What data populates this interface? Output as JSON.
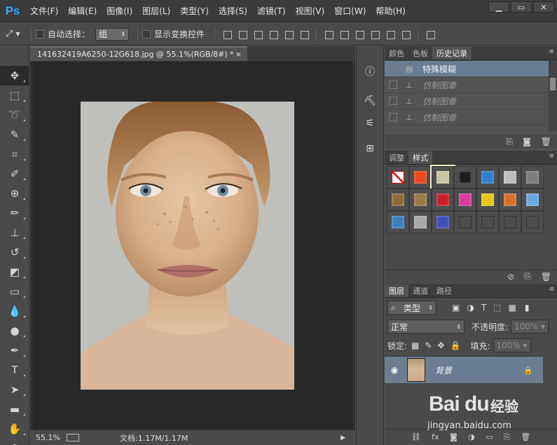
{
  "app": {
    "logo": "Ps"
  },
  "menu": [
    "文件(F)",
    "编辑(E)",
    "图像(I)",
    "图层(L)",
    "类型(Y)",
    "选择(S)",
    "滤镜(T)",
    "视图(V)",
    "窗口(W)",
    "帮助(H)"
  ],
  "window_controls": [
    "▁",
    "▭",
    "✕"
  ],
  "options": {
    "auto_select_label": "自动选择：",
    "auto_select_value": "组",
    "show_transform_label": "显示变换控件"
  },
  "document": {
    "tab_title": "141632419A6250-12G618.jpg @ 55.1%(RGB/8#) *",
    "tab_close": "×",
    "zoom": "55.1%",
    "doc_info": "文档:1.17M/1.17M",
    "status_arrow": "▶"
  },
  "history_panel": {
    "tabs": [
      "颜色",
      "色板",
      "历史记录"
    ],
    "active_tab": 2,
    "items": [
      {
        "label": "特殊模糊",
        "active": true
      },
      {
        "label": "仿制图章",
        "active": false
      },
      {
        "label": "仿制图章",
        "active": false
      },
      {
        "label": "仿制图章",
        "active": false
      }
    ]
  },
  "styles_panel": {
    "tabs": [
      "调整",
      "样式"
    ],
    "active_tab": 1,
    "swatches": [
      "none",
      "#e84a1c",
      "#c9c4a0",
      "#1c1c1c",
      "#2f7fd0",
      "#bdbdbd",
      "#7d7d7d",
      "#8d6a3a",
      "#9a7b46",
      "#c8202a",
      "#d63a9a",
      "#e8c51a",
      "#d4702a",
      "#6aa7e0",
      "#3e7fbe",
      "#a9a9a9",
      "#3f4fb8",
      "empty",
      "empty",
      "empty",
      "empty"
    ]
  },
  "layers_panel": {
    "tabs": [
      "图层",
      "通道",
      "路径"
    ],
    "active_tab": 0,
    "filter_kind": "类型",
    "blend_mode": "正常",
    "opacity_label": "不透明度:",
    "opacity_value": "100%",
    "lock_label": "锁定:",
    "fill_label": "填充:",
    "fill_value": "100%",
    "layers": [
      {
        "name": "背景",
        "visible": true,
        "locked": true
      }
    ]
  },
  "watermark": {
    "brand": "Bai du",
    "brand_cn": "经验",
    "url": "jingyan.baidu.com"
  },
  "colors": {
    "menubar_bg": "#3b3b3b",
    "panel_bg": "#4a4a4a",
    "selection": "#6a7d92",
    "ps_blue": "#31a8ff"
  }
}
